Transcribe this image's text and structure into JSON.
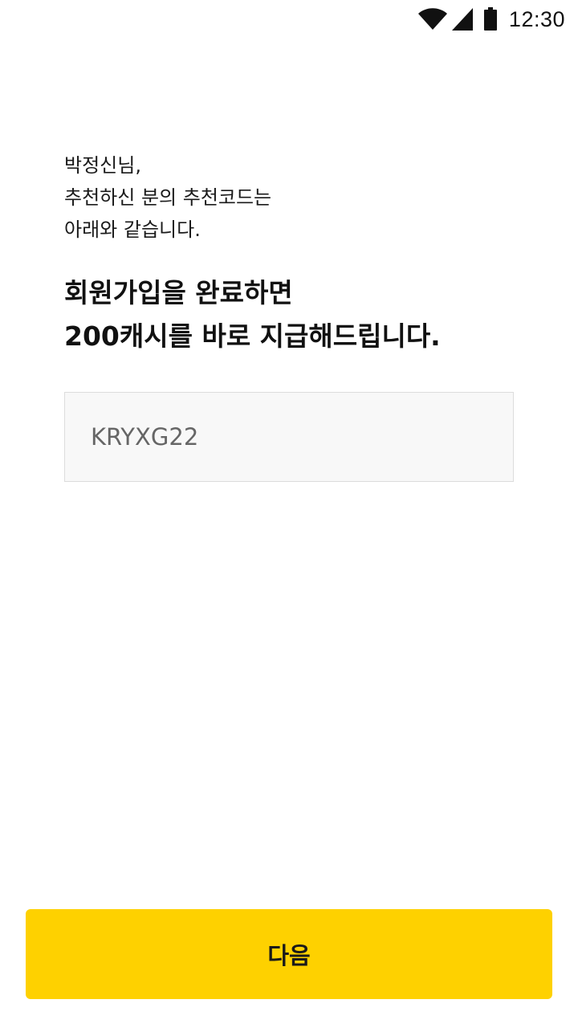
{
  "status_bar": {
    "time": "12:30",
    "icons": [
      "wifi-icon",
      "signal-icon",
      "battery-icon"
    ]
  },
  "greeting": {
    "lines": [
      "박정신님,",
      "추천하신 분의 추천코드는",
      "아래와 같습니다."
    ]
  },
  "headline": {
    "lines": [
      "회원가입을 완료하면",
      "200캐시를 바로 지급해드립니다."
    ]
  },
  "referral_code": {
    "value": "KRYXG22"
  },
  "next_button": {
    "label": "다음"
  },
  "colors": {
    "accent": "#fed100",
    "code_box_bg": "#f8f8f8",
    "code_box_border": "#dcdcdc",
    "code_text": "#666666"
  }
}
